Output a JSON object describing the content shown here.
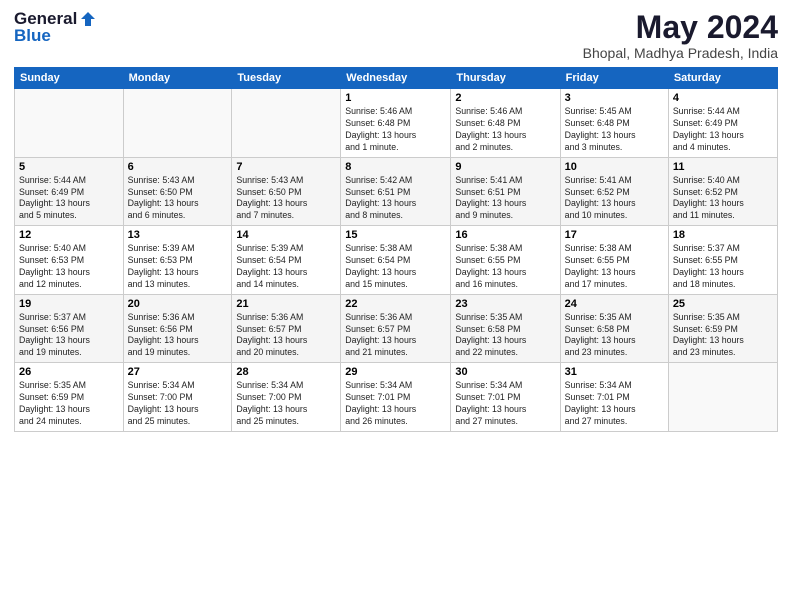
{
  "logo": {
    "general": "General",
    "blue": "Blue"
  },
  "title": "May 2024",
  "subtitle": "Bhopal, Madhya Pradesh, India",
  "days_of_week": [
    "Sunday",
    "Monday",
    "Tuesday",
    "Wednesday",
    "Thursday",
    "Friday",
    "Saturday"
  ],
  "weeks": [
    [
      {
        "day": "",
        "info": ""
      },
      {
        "day": "",
        "info": ""
      },
      {
        "day": "",
        "info": ""
      },
      {
        "day": "1",
        "info": "Sunrise: 5:46 AM\nSunset: 6:48 PM\nDaylight: 13 hours\nand 1 minute."
      },
      {
        "day": "2",
        "info": "Sunrise: 5:46 AM\nSunset: 6:48 PM\nDaylight: 13 hours\nand 2 minutes."
      },
      {
        "day": "3",
        "info": "Sunrise: 5:45 AM\nSunset: 6:48 PM\nDaylight: 13 hours\nand 3 minutes."
      },
      {
        "day": "4",
        "info": "Sunrise: 5:44 AM\nSunset: 6:49 PM\nDaylight: 13 hours\nand 4 minutes."
      }
    ],
    [
      {
        "day": "5",
        "info": "Sunrise: 5:44 AM\nSunset: 6:49 PM\nDaylight: 13 hours\nand 5 minutes."
      },
      {
        "day": "6",
        "info": "Sunrise: 5:43 AM\nSunset: 6:50 PM\nDaylight: 13 hours\nand 6 minutes."
      },
      {
        "day": "7",
        "info": "Sunrise: 5:43 AM\nSunset: 6:50 PM\nDaylight: 13 hours\nand 7 minutes."
      },
      {
        "day": "8",
        "info": "Sunrise: 5:42 AM\nSunset: 6:51 PM\nDaylight: 13 hours\nand 8 minutes."
      },
      {
        "day": "9",
        "info": "Sunrise: 5:41 AM\nSunset: 6:51 PM\nDaylight: 13 hours\nand 9 minutes."
      },
      {
        "day": "10",
        "info": "Sunrise: 5:41 AM\nSunset: 6:52 PM\nDaylight: 13 hours\nand 10 minutes."
      },
      {
        "day": "11",
        "info": "Sunrise: 5:40 AM\nSunset: 6:52 PM\nDaylight: 13 hours\nand 11 minutes."
      }
    ],
    [
      {
        "day": "12",
        "info": "Sunrise: 5:40 AM\nSunset: 6:53 PM\nDaylight: 13 hours\nand 12 minutes."
      },
      {
        "day": "13",
        "info": "Sunrise: 5:39 AM\nSunset: 6:53 PM\nDaylight: 13 hours\nand 13 minutes."
      },
      {
        "day": "14",
        "info": "Sunrise: 5:39 AM\nSunset: 6:54 PM\nDaylight: 13 hours\nand 14 minutes."
      },
      {
        "day": "15",
        "info": "Sunrise: 5:38 AM\nSunset: 6:54 PM\nDaylight: 13 hours\nand 15 minutes."
      },
      {
        "day": "16",
        "info": "Sunrise: 5:38 AM\nSunset: 6:55 PM\nDaylight: 13 hours\nand 16 minutes."
      },
      {
        "day": "17",
        "info": "Sunrise: 5:38 AM\nSunset: 6:55 PM\nDaylight: 13 hours\nand 17 minutes."
      },
      {
        "day": "18",
        "info": "Sunrise: 5:37 AM\nSunset: 6:55 PM\nDaylight: 13 hours\nand 18 minutes."
      }
    ],
    [
      {
        "day": "19",
        "info": "Sunrise: 5:37 AM\nSunset: 6:56 PM\nDaylight: 13 hours\nand 19 minutes."
      },
      {
        "day": "20",
        "info": "Sunrise: 5:36 AM\nSunset: 6:56 PM\nDaylight: 13 hours\nand 19 minutes."
      },
      {
        "day": "21",
        "info": "Sunrise: 5:36 AM\nSunset: 6:57 PM\nDaylight: 13 hours\nand 20 minutes."
      },
      {
        "day": "22",
        "info": "Sunrise: 5:36 AM\nSunset: 6:57 PM\nDaylight: 13 hours\nand 21 minutes."
      },
      {
        "day": "23",
        "info": "Sunrise: 5:35 AM\nSunset: 6:58 PM\nDaylight: 13 hours\nand 22 minutes."
      },
      {
        "day": "24",
        "info": "Sunrise: 5:35 AM\nSunset: 6:58 PM\nDaylight: 13 hours\nand 23 minutes."
      },
      {
        "day": "25",
        "info": "Sunrise: 5:35 AM\nSunset: 6:59 PM\nDaylight: 13 hours\nand 23 minutes."
      }
    ],
    [
      {
        "day": "26",
        "info": "Sunrise: 5:35 AM\nSunset: 6:59 PM\nDaylight: 13 hours\nand 24 minutes."
      },
      {
        "day": "27",
        "info": "Sunrise: 5:34 AM\nSunset: 7:00 PM\nDaylight: 13 hours\nand 25 minutes."
      },
      {
        "day": "28",
        "info": "Sunrise: 5:34 AM\nSunset: 7:00 PM\nDaylight: 13 hours\nand 25 minutes."
      },
      {
        "day": "29",
        "info": "Sunrise: 5:34 AM\nSunset: 7:01 PM\nDaylight: 13 hours\nand 26 minutes."
      },
      {
        "day": "30",
        "info": "Sunrise: 5:34 AM\nSunset: 7:01 PM\nDaylight: 13 hours\nand 27 minutes."
      },
      {
        "day": "31",
        "info": "Sunrise: 5:34 AM\nSunset: 7:01 PM\nDaylight: 13 hours\nand 27 minutes."
      },
      {
        "day": "",
        "info": ""
      }
    ]
  ]
}
